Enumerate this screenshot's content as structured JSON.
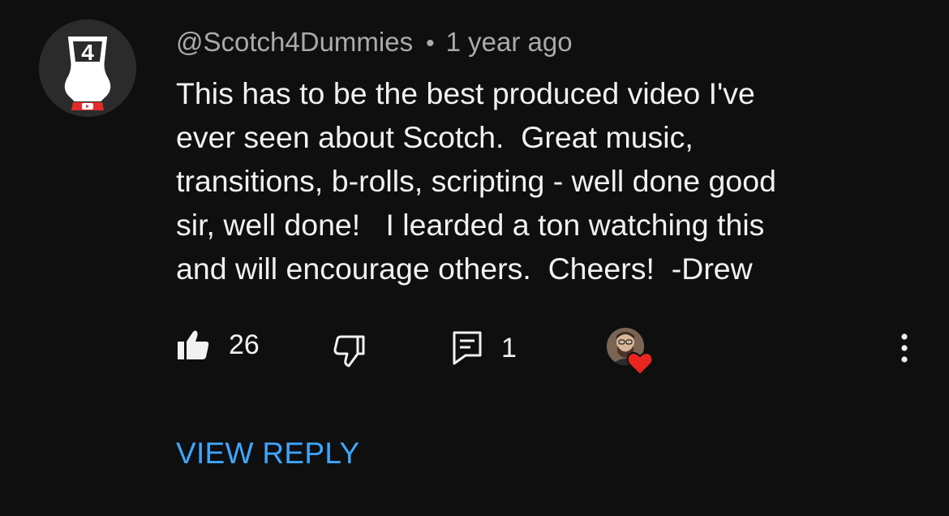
{
  "comment": {
    "author": "@Scotch4Dummies",
    "separator": "•",
    "timestamp": "1 year ago",
    "avatar_icon": "scotch-glass-4-logo-icon",
    "avatar_logo_text": "4",
    "text_lines": [
      "This has to be the best produced video I've",
      "ever seen about Scotch.  Great music,",
      "transitions, b-rolls, scripting - well done good",
      "sir, well done!   I learded a ton watching this",
      "and will encourage others.  Cheers!  -Drew"
    ]
  },
  "actions": {
    "like_icon": "thumbs-up-filled-icon",
    "like_count": "26",
    "dislike_icon": "thumbs-down-outline-icon",
    "reply_icon": "comment-icon",
    "reply_count": "1",
    "creator_heart_icon": "heart-icon",
    "more_icon": "more-vertical-icon"
  },
  "view_reply_label": "VIEW REPLY",
  "colors": {
    "background": "#0f0f0f",
    "text_primary": "#f1f1f1",
    "text_secondary": "#aaaaaa",
    "link": "#3ea6ff",
    "heart": "#e8261f",
    "logo_red": "#e32b2b"
  }
}
